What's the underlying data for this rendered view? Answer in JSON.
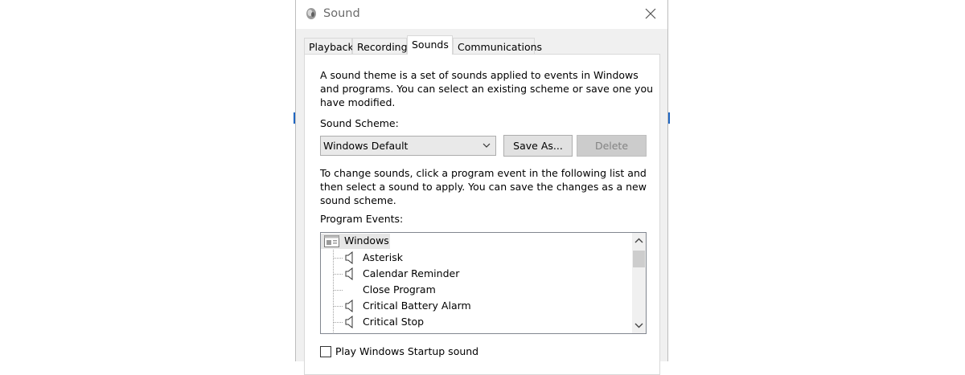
{
  "window": {
    "title": "Sound",
    "tabs": [
      {
        "label": "Playback",
        "active": false
      },
      {
        "label": "Recording",
        "active": false
      },
      {
        "label": "Sounds",
        "active": true
      },
      {
        "label": "Communications",
        "active": false
      }
    ]
  },
  "sounds_tab": {
    "intro": "A sound theme is a set of sounds applied to events in Windows and programs.  You can select an existing scheme or save one you have modified.",
    "scheme_label": "Sound Scheme:",
    "scheme_value": "Windows Default",
    "save_as_label": "Save As...",
    "delete_label": "Delete",
    "change_text": "To change sounds, click a program event in the following list and then select a sound to apply.  You can save the changes as a new sound scheme.",
    "events_label": "Program Events:",
    "events": {
      "group": "Windows",
      "items": [
        {
          "label": "Asterisk",
          "has_sound": true
        },
        {
          "label": "Calendar Reminder",
          "has_sound": true
        },
        {
          "label": "Close Program",
          "has_sound": false
        },
        {
          "label": "Critical Battery Alarm",
          "has_sound": true
        },
        {
          "label": "Critical Stop",
          "has_sound": true
        }
      ]
    },
    "startup_sound_label": "Play Windows Startup sound",
    "startup_sound_checked": false
  },
  "colors": {
    "accent_edge": "#1f66c2",
    "disabled_button": "#cccccc"
  }
}
